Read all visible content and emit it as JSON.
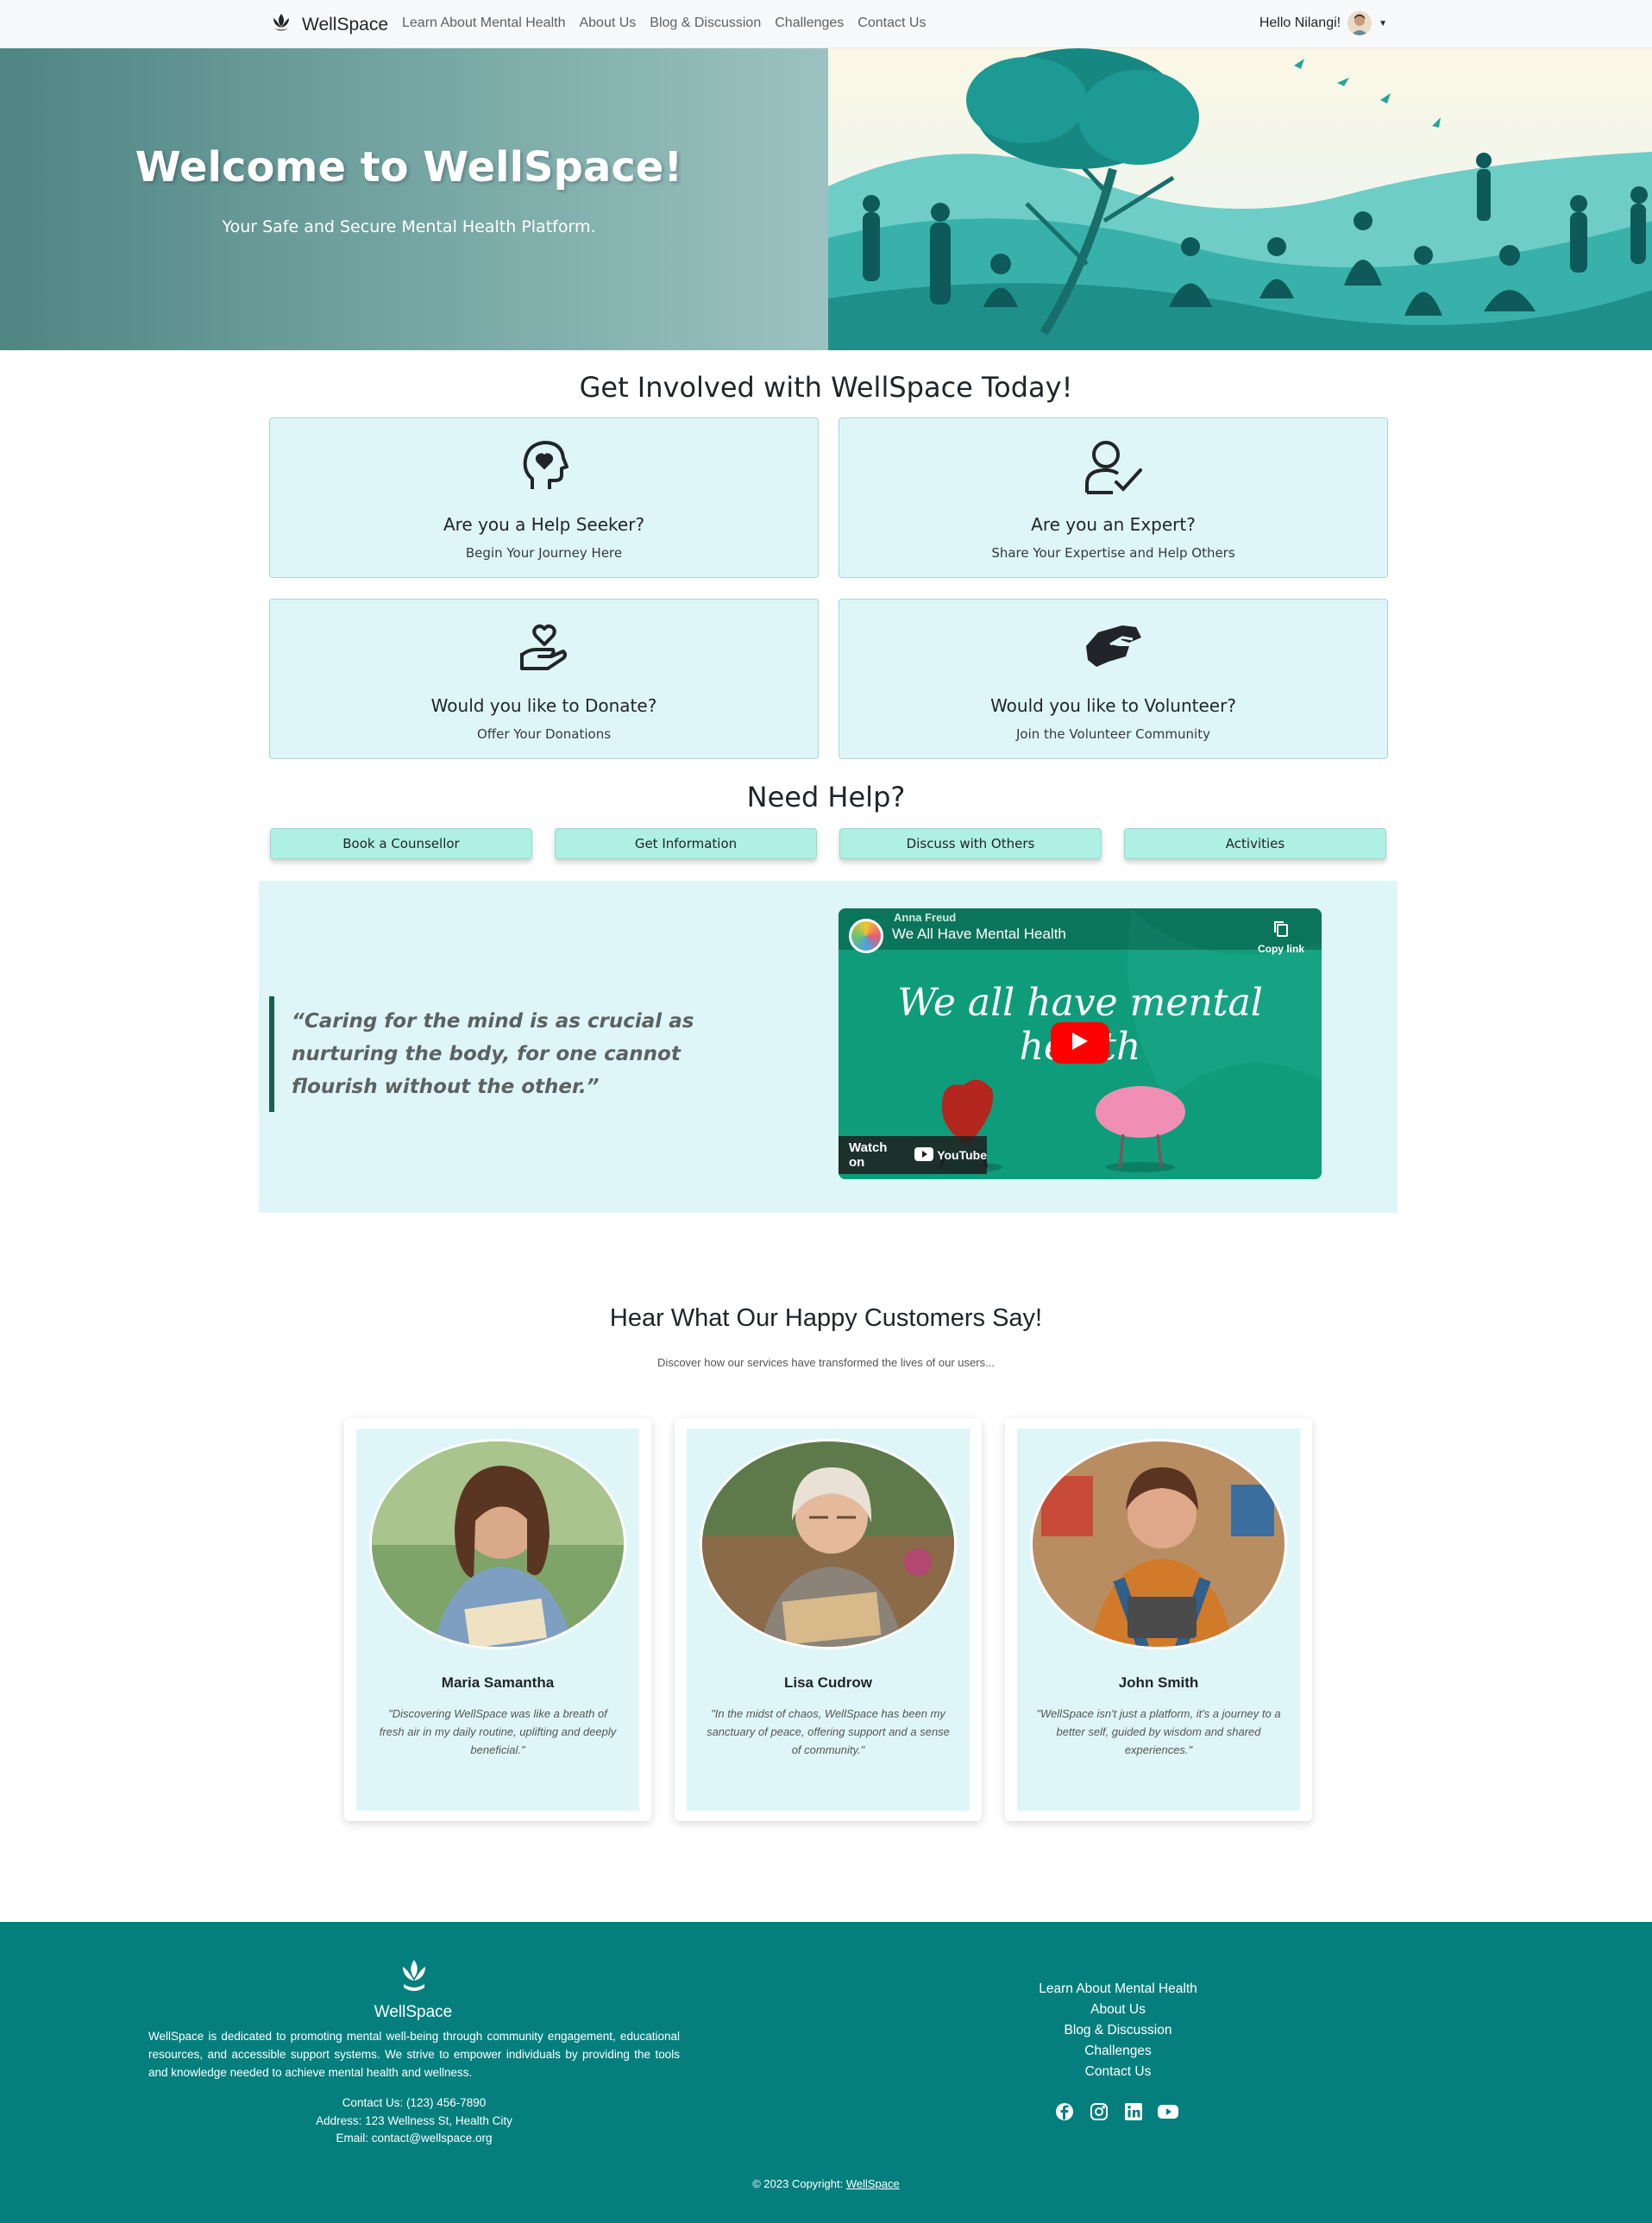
{
  "nav": {
    "brand": "WellSpace",
    "links": [
      "Learn About Mental Health",
      "About Us",
      "Blog & Discussion",
      "Challenges",
      "Contact Us"
    ],
    "greeting": "Hello Nilangi!"
  },
  "hero": {
    "title": "Welcome to WellSpace!",
    "subtitle": "Your Safe and Secure Mental Health Platform."
  },
  "involve": {
    "heading": "Get Involved with WellSpace Today!",
    "cards": [
      {
        "title": "Are you a Help Seeker?",
        "subtitle": "Begin Your Journey Here",
        "icon": "head-heart-icon"
      },
      {
        "title": "Are you an Expert?",
        "subtitle": "Share Your Expertise and Help Others",
        "icon": "user-check-icon"
      },
      {
        "title": "Would you like to Donate?",
        "subtitle": "Offer Your Donations",
        "icon": "hand-heart-icon"
      },
      {
        "title": "Would you like to Volunteer?",
        "subtitle": "Join the Volunteer Community",
        "icon": "handshake-icon"
      }
    ]
  },
  "help": {
    "heading": "Need Help?",
    "buttons": [
      "Book a Counsellor",
      "Get Information",
      "Discuss with Others",
      "Activities"
    ]
  },
  "quote": {
    "text": "“Caring for the mind is as crucial as nurturing the body, for one cannot flourish without the other.”"
  },
  "video": {
    "channel": "Anna Freud",
    "title": "We All Have Mental Health",
    "copy_link": "Copy link",
    "overlay_text": "We all have mental health",
    "watch_on": "Watch on",
    "platform": "YouTube"
  },
  "testimonials": {
    "heading": "Hear What Our Happy Customers Say!",
    "subheading": "Discover how our services have transformed the lives of our users...",
    "items": [
      {
        "name": "Maria Samantha",
        "quote": "\"Discovering WellSpace was like a breath of fresh air in my daily routine, uplifting and deeply beneficial.\""
      },
      {
        "name": "Lisa Cudrow",
        "quote": "\"In the midst of chaos, WellSpace has been my sanctuary of peace, offering support and a sense of community.\""
      },
      {
        "name": "John Smith",
        "quote": "\"WellSpace isn't just a platform, it's a journey to a better self, guided by wisdom and shared experiences.\""
      }
    ]
  },
  "footer": {
    "brand": "WellSpace",
    "description": "WellSpace is dedicated to promoting mental well-being through community engagement, educational resources, and accessible support systems. We strive to empower individuals by providing the tools and knowledge needed to achieve mental health and wellness.",
    "contact": "Contact Us: (123) 456-7890",
    "address": "Address: 123 Wellness St, Health City",
    "email": "Email: contact@wellspace.org",
    "links": [
      "Learn About Mental Health",
      "About Us",
      "Blog & Discussion",
      "Challenges",
      "Contact Us"
    ],
    "social": [
      "facebook-icon",
      "instagram-icon",
      "linkedin-icon",
      "youtube-icon"
    ],
    "copyright": "© 2023 Copyright:",
    "copyright_link": "WellSpace"
  },
  "colors": {
    "footer_bg": "#047f7e",
    "card_bg": "#dff6f8",
    "button_bg": "#aef0e4",
    "quote_border": "#19604f"
  }
}
